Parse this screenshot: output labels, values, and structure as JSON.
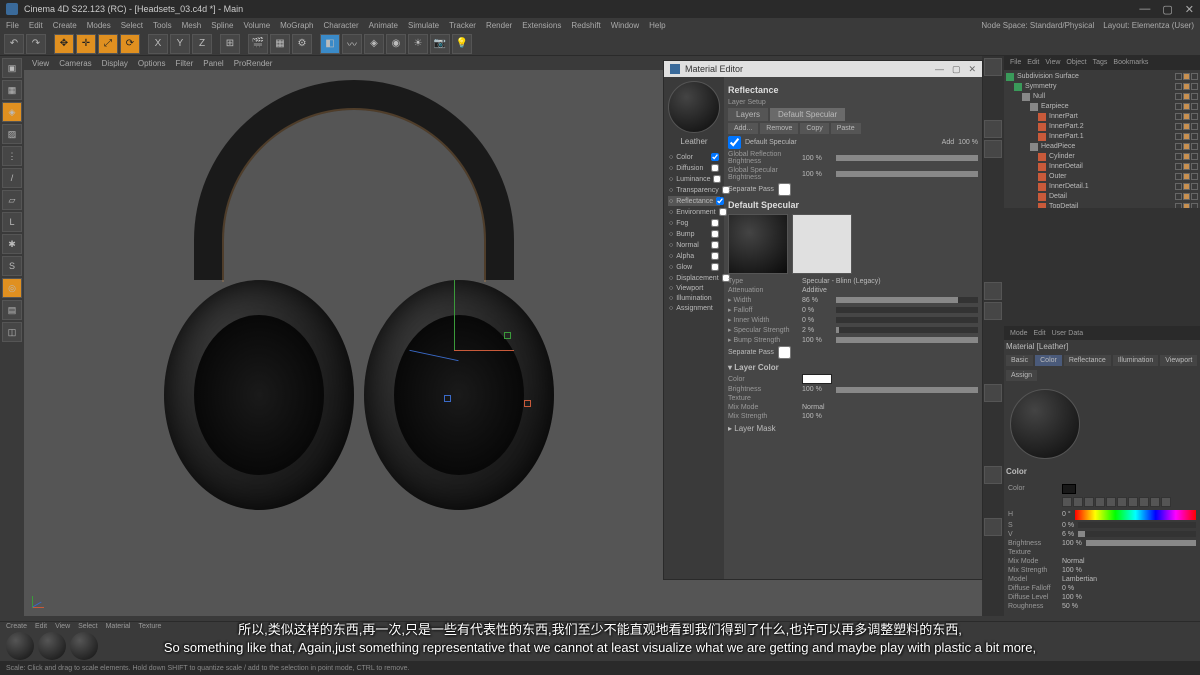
{
  "titlebar": {
    "app": "Cinema 4D S22.123 (RC) - [Headsets_03.c4d *] - Main"
  },
  "menubar": {
    "items": [
      "File",
      "Edit",
      "Create",
      "Modes",
      "Select",
      "Tools",
      "Mesh",
      "Spline",
      "Volume",
      "MoGraph",
      "Character",
      "Animate",
      "Simulate",
      "Tracker",
      "Render",
      "Extensions",
      "Redshift",
      "Window",
      "Help"
    ],
    "node_space": "Node Space:",
    "node_space_val": "Standard/Physical",
    "layout": "Layout:",
    "layout_val": "Elementza (User)"
  },
  "viewport_menu": [
    "View",
    "Cameras",
    "Display",
    "Options",
    "Filter",
    "Panel",
    "ProRender"
  ],
  "mat_editor": {
    "title": "Material Editor",
    "material_name": "Leather",
    "section_reflectance": "Reflectance",
    "layer_setup": "Layer Setup",
    "tab_layers": "Layers",
    "tab_default_specular": "Default Specular",
    "btn_add": "Add...",
    "btn_remove": "Remove",
    "btn_copy": "Copy",
    "btn_paste": "Paste",
    "default_spec_label": "Default Specular",
    "add2": "Add",
    "pct100": "100 %",
    "global_reflection": "Global Reflection Brightness",
    "global_specular": "Global Specular Brightness",
    "separate_pass": "Separate Pass",
    "default_specular_header": "Default Specular",
    "type": "Type",
    "type_val": "Specular - Blinn (Legacy)",
    "attenuation": "Attenuation",
    "attenuation_val": "Additive",
    "width_label": "Width",
    "width_val": "86 %",
    "falloff": "Falloff",
    "falloff_val": "0 %",
    "inner_width": "Inner Width",
    "inner_width_val": "0 %",
    "spec_strength": "Specular Strength",
    "spec_strength_val": "2 %",
    "bump_strength": "Bump Strength",
    "bump_strength_val": "100 %",
    "layer_color": "Layer Color",
    "color_label": "Color",
    "brightness": "Brightness",
    "brightness_val": "100 %",
    "texture": "Texture",
    "mix_mode": "Mix Mode",
    "mix_mode_val": "Normal",
    "mix_strength": "Mix Strength",
    "mix_strength_val": "100 %",
    "layer_mask": "Layer Mask",
    "channels": [
      "Color",
      "Diffusion",
      "Luminance",
      "Transparency",
      "Reflectance",
      "Environment",
      "Fog",
      "Bump",
      "Normal",
      "Alpha",
      "Glow",
      "Displacement",
      "Viewport",
      "Illumination",
      "Assignment"
    ],
    "channels_checked": [
      true,
      false,
      false,
      false,
      true,
      false,
      false,
      false,
      false,
      false,
      false,
      false,
      null,
      null,
      null
    ]
  },
  "objects": {
    "menu": [
      "File",
      "Edit",
      "View",
      "Object",
      "Tags",
      "Bookmarks"
    ],
    "tree": [
      {
        "name": "Subdivision Surface",
        "indent": 0,
        "color": "#3a9a5a"
      },
      {
        "name": "Symmetry",
        "indent": 1,
        "color": "#3a9a5a"
      },
      {
        "name": "Null",
        "indent": 2,
        "color": "#888"
      },
      {
        "name": "Earpiece",
        "indent": 3,
        "color": "#888"
      },
      {
        "name": "InnerPart",
        "indent": 4,
        "color": "#c85a3a"
      },
      {
        "name": "InnerPart.2",
        "indent": 4,
        "color": "#c85a3a"
      },
      {
        "name": "InnerPart.1",
        "indent": 4,
        "color": "#c85a3a"
      },
      {
        "name": "HeadPiece",
        "indent": 3,
        "color": "#888"
      },
      {
        "name": "Cylinder",
        "indent": 4,
        "color": "#c85a3a"
      },
      {
        "name": "InnerDetail",
        "indent": 4,
        "color": "#c85a3a"
      },
      {
        "name": "Outer",
        "indent": 4,
        "color": "#c85a3a"
      },
      {
        "name": "InnerDetail.1",
        "indent": 4,
        "color": "#c85a3a"
      },
      {
        "name": "Detail",
        "indent": 4,
        "color": "#c85a3a"
      },
      {
        "name": "TopDetail",
        "indent": 4,
        "color": "#c85a3a"
      }
    ]
  },
  "attributes": {
    "menu": [
      "Mode",
      "Edit",
      "User Data"
    ],
    "title": "Material [Leather]",
    "tabs": [
      "Basic",
      "Color",
      "Reflectance",
      "Illumination",
      "Viewport"
    ],
    "tab_assign": "Assign",
    "color_header": "Color",
    "color_lbl": "Color",
    "h": "H",
    "h_val": "0 °",
    "s": "S",
    "s_val": "0 %",
    "v": "V",
    "v_val": "6 %",
    "brightness": "Brightness",
    "brightness_val": "100 %",
    "texture": "Texture",
    "mix_mode": "Mix Mode",
    "mix_mode_val": "Normal",
    "mix_strength": "Mix Strength",
    "mix_strength_val": "100 %",
    "model": "Model",
    "model_val": "Lambertian",
    "diffuse_falloff": "Diffuse Falloff",
    "diffuse_falloff_val": "0 %",
    "diffuse_level": "Diffuse Level",
    "diffuse_level_val": "100 %",
    "roughness": "Roughness",
    "roughness_val": "50 %"
  },
  "mat_strip": {
    "menu": [
      "Create",
      "Edit",
      "View",
      "Select",
      "Material",
      "Texture"
    ]
  },
  "subtitle": {
    "cn": "所以,类似这样的东西,再一次,只是一些有代表性的东西,我们至少不能直观地看到我们得到了什么,也许可以再多调整塑料的东西,",
    "en": "So something like that, Again,just something representative that we cannot at least visualize what we are getting and maybe play with plastic a bit more,"
  },
  "status": "Scale: Click and drag to scale elements. Hold down SHIFT to quantize scale / add to the selection in point mode, CTRL to remove."
}
